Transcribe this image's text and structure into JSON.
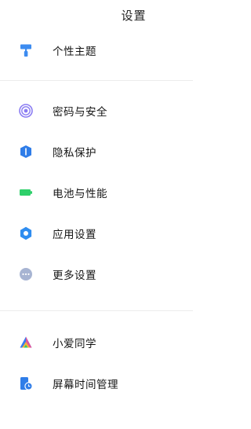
{
  "header": {
    "title": "设置"
  },
  "groups": [
    {
      "items": [
        {
          "label": "个性主题",
          "icon": "paint-roller-icon",
          "color": "#3d8cf0"
        }
      ]
    },
    {
      "items": [
        {
          "label": "密码与安全",
          "icon": "fingerprint-icon",
          "color": "#7c6cf0"
        },
        {
          "label": "隐私保护",
          "icon": "shield-icon",
          "color": "#2f7de8"
        },
        {
          "label": "电池与性能",
          "icon": "battery-icon",
          "color": "#2ecf6a"
        },
        {
          "label": "应用设置",
          "icon": "gear-icon",
          "color": "#2f8df0"
        },
        {
          "label": "更多设置",
          "icon": "more-dots-icon",
          "color": "#9aaac8"
        }
      ]
    },
    {
      "items": [
        {
          "label": "小爱同学",
          "icon": "xiaoai-icon",
          "color": "#3a7bf0"
        },
        {
          "label": "屏幕时间管理",
          "icon": "screen-time-icon",
          "color": "#2f7de8"
        }
      ]
    }
  ]
}
